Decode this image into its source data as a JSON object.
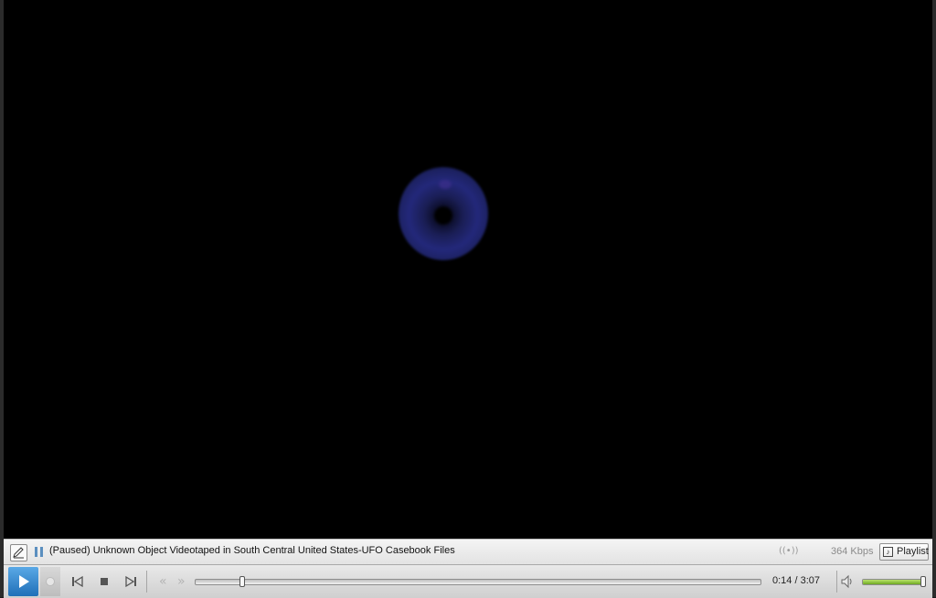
{
  "player": {
    "status_text": "(Paused) Unknown Object Videotaped in South Central United States-UFO Casebook Files",
    "stream_icon_label": "((•))",
    "bitrate": "364 Kbps",
    "playlist_label": "Playlist"
  },
  "controls": {
    "rewind_label": "«",
    "fast_forward_label": "»",
    "time": "0:14 / 3:07",
    "seek_fraction": 0.082,
    "volume_fraction": 0.97
  },
  "icons": {
    "edit": "pencil-icon",
    "pause": "pause-icon",
    "play": "play-icon",
    "record": "record-icon",
    "prev": "previous-track-icon",
    "stop": "stop-icon",
    "next": "next-track-icon",
    "volume": "speaker-icon",
    "playlist": "playlist-icon"
  },
  "colors": {
    "video_background": "#000000",
    "play_button": "#2f86d2",
    "volume_fill": "#8cc63f"
  }
}
